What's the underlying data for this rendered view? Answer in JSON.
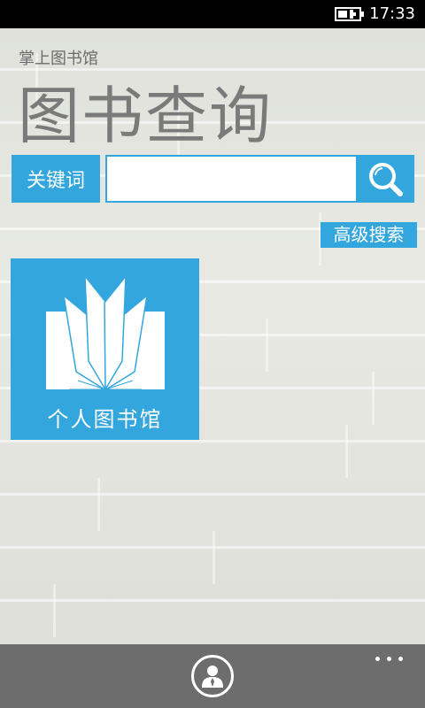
{
  "status_bar": {
    "time": "17:33",
    "battery_icon": "battery-charging-icon"
  },
  "header": {
    "app_title": "掌上图书馆",
    "page_title": "图书查询"
  },
  "search": {
    "keyword_label": "关键词",
    "input_value": "",
    "input_placeholder": "",
    "search_icon": "magnifier-icon",
    "advanced_search_label": "高级搜索"
  },
  "tiles": {
    "personal_library": {
      "label": "个人图书馆",
      "icon": "open-book-icon"
    }
  },
  "app_bar": {
    "profile_icon": "user-profile-icon",
    "more_icon": "ellipsis-icon"
  },
  "colors": {
    "accent": "#33a6dd",
    "app_bar": "#6d6d6d",
    "status_bar": "#000000",
    "title_text": "#7a7a7a"
  }
}
